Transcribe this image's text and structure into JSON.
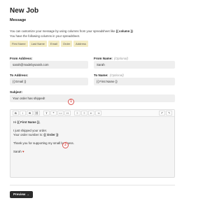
{
  "header": {
    "title": "New Job",
    "section": "Message"
  },
  "intro": {
    "line1_prefix": "You can customize your message by using columns from your spreadsheet like",
    "line1_token": "{{ column }}",
    "line2": "You have the following columns in your spreadsheet."
  },
  "columns": [
    "First Name",
    "Last Name",
    "Email",
    "Order",
    "Address"
  ],
  "from_address": {
    "label": "From Address:",
    "value": "sarah@madebysarah.com"
  },
  "from_name": {
    "label": "From Name:",
    "optional": "(Optional)",
    "value": "Sarah"
  },
  "to_address": {
    "label": "To Address:",
    "value": "{{ Email }}",
    "badge": "1"
  },
  "to_name": {
    "label": "To Name:",
    "optional": "(Optional)",
    "value": "{{ First Name }}"
  },
  "subject": {
    "label": "Subject:",
    "value": "Your order has shipped!"
  },
  "editor": {
    "toolbar": [
      "B",
      "I",
      "S",
      "⛓",
      "T",
      "❝",
      "<>",
      "H",
      "≡",
      "≡",
      "⇤",
      "⇥",
      "↶",
      "↷"
    ],
    "badge": "2",
    "lines": [
      "Hi {{ First Name }},",
      "",
      "I just shipped your order.",
      "Your order number is: {{ Order }}",
      "",
      "Thank you for supporting my small business.",
      "",
      "Sarah"
    ],
    "heart": "♥"
  },
  "actions": {
    "preview_label": "Preview →"
  }
}
